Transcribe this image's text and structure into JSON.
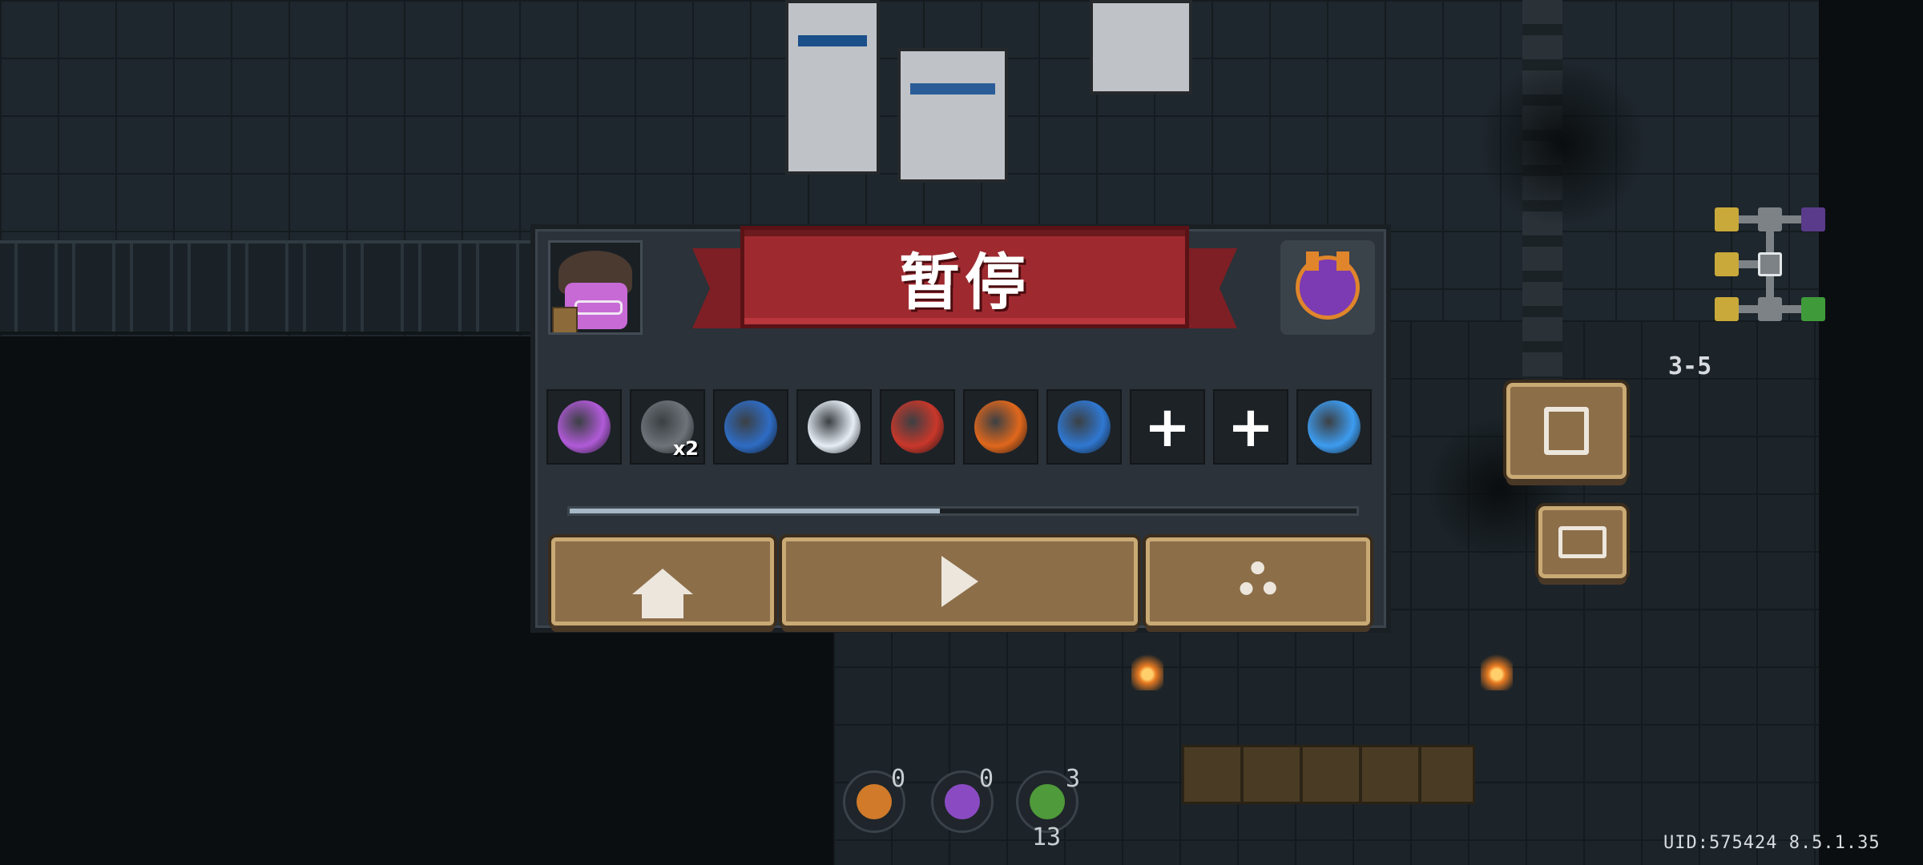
{
  "pause_title": "暂停",
  "skill_slots": [
    {
      "id": "aura-helmet",
      "color": "#b15ad8"
    },
    {
      "id": "knight-clone",
      "color": "#6d7379",
      "count": "x2"
    },
    {
      "id": "shield-shards",
      "color": "#2e6cc4"
    },
    {
      "id": "frost-shield",
      "color": "#e6eef5"
    },
    {
      "id": "red-slash",
      "color": "#c9372a"
    },
    {
      "id": "fire-wave",
      "color": "#e0671c"
    },
    {
      "id": "hourglass",
      "color": "#2f78d2"
    },
    {
      "id": "empty-slot"
    },
    {
      "id": "empty-slot"
    },
    {
      "id": "mind-boost",
      "color": "#3d9cf0"
    }
  ],
  "progress_fraction": 0.47,
  "buttons": {
    "home": "home-icon",
    "resume": "play-icon",
    "settings": "gear-icon"
  },
  "level_label": "3-5",
  "resources": [
    {
      "id": "fist-resource",
      "count": "0"
    },
    {
      "id": "helmet-resource",
      "count": "0"
    },
    {
      "id": "armor-resource",
      "count": "3",
      "sub": "13"
    }
  ],
  "uid_text": "UID:575424 8.5.1.35"
}
